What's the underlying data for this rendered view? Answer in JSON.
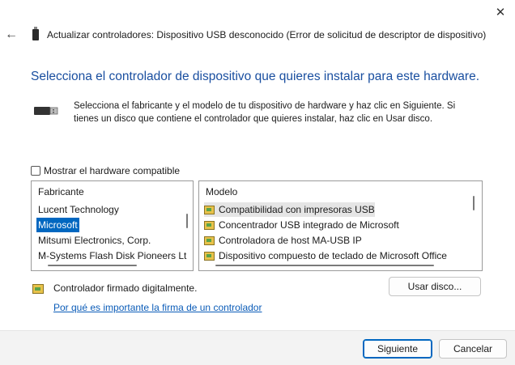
{
  "window": {
    "title": "Actualizar controladores: Dispositivo USB desconocido (Error de solicitud de descriptor de dispositivo)",
    "close_glyph": "✕",
    "back_glyph": "←"
  },
  "heading": "Selecciona el controlador de dispositivo que quieres instalar para este hardware.",
  "description": "Selecciona el fabricante y el modelo de tu dispositivo de hardware y haz clic en Siguiente. Si tienes un disco que contiene el controlador que quieres instalar, haz clic en Usar disco.",
  "compatible_checkbox": {
    "label": "Mostrar el hardware compatible",
    "checked": false
  },
  "manufacturers": {
    "header": "Fabricante",
    "items": [
      "Lucent Technology",
      "Microsoft",
      "Mitsumi Electronics, Corp.",
      "M-Systems Flash Disk Pioneers Lt"
    ],
    "selected": "Microsoft"
  },
  "models": {
    "header": "Modelo",
    "items": [
      "Compatibilidad con impresoras USB",
      "Concentrador USB integrado de Microsoft",
      "Controladora de host MA-USB IP",
      "Dispositivo compuesto de teclado de Microsoft Office"
    ],
    "selected": "Compatibilidad con impresoras USB"
  },
  "signed": {
    "text": "Controlador firmado digitalmente.",
    "link": "Por qué es importante la firma de un controlador"
  },
  "buttons": {
    "have_disk": "Usar disco...",
    "next": "Siguiente",
    "cancel": "Cancelar"
  },
  "colors": {
    "accent": "#0067c0",
    "heading": "#1a4fa0",
    "link": "#0b5cb8"
  }
}
